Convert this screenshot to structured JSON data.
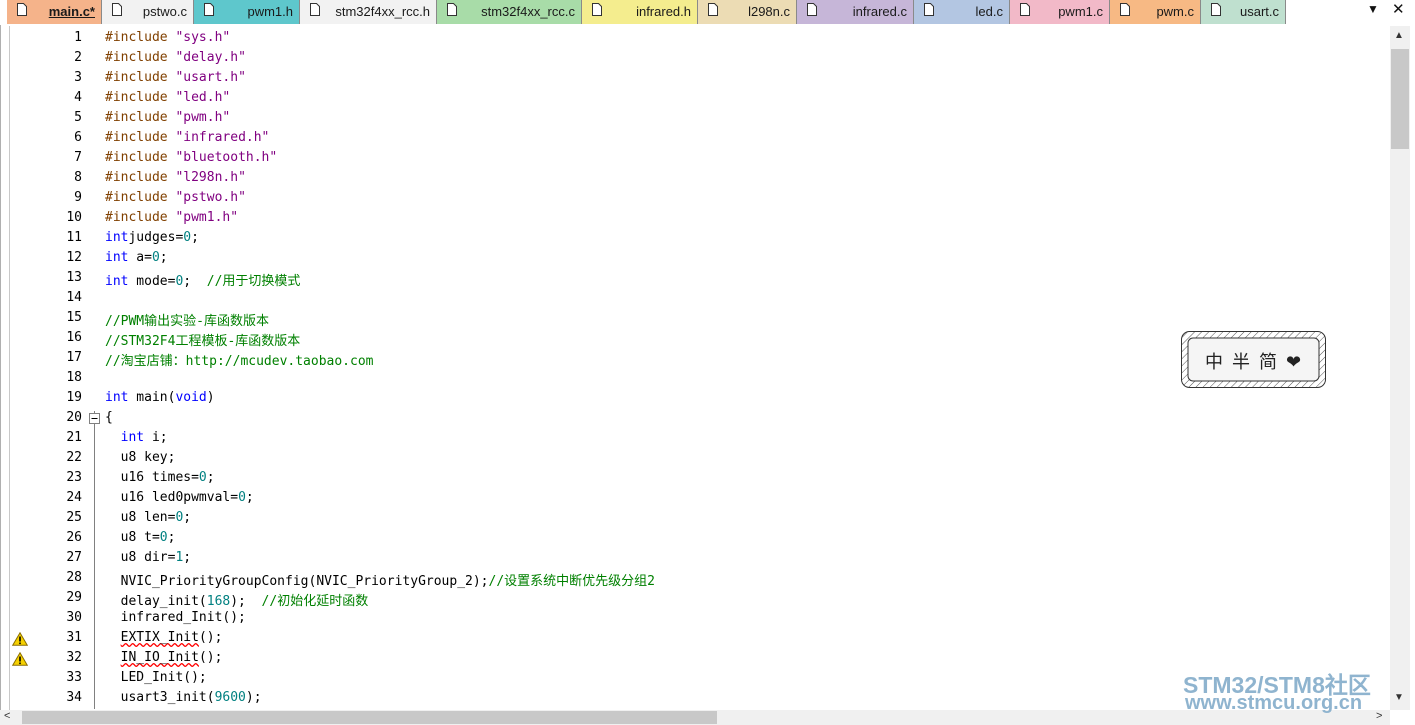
{
  "tabs": [
    {
      "label": "main.c*",
      "color": "#f5b38a",
      "active": true
    },
    {
      "label": "pstwo.c",
      "color": "#f2f2f2",
      "active": false
    },
    {
      "label": "pwm1.h",
      "color": "#5ec7cc",
      "active": false
    },
    {
      "label": "stm32f4xx_rcc.h",
      "color": "#f2f2f2",
      "active": false
    },
    {
      "label": "stm32f4xx_rcc.c",
      "color": "#a8dca8",
      "active": false
    },
    {
      "label": "infrared.h",
      "color": "#f4ed8e",
      "active": false
    },
    {
      "label": "l298n.c",
      "color": "#ecdcb4",
      "active": false
    },
    {
      "label": "infrared.c",
      "color": "#c6b6d8",
      "active": false
    },
    {
      "label": "led.c",
      "color": "#b3c6e2",
      "active": false
    },
    {
      "label": "pwm1.c",
      "color": "#f2b9c8",
      "active": false
    },
    {
      "label": "pwm.c",
      "color": "#f7b984",
      "active": false
    },
    {
      "label": "usart.c",
      "color": "#bfe0cf",
      "active": false
    }
  ],
  "tab_controls": {
    "menu": "▼",
    "close": "✕"
  },
  "lines": [
    {
      "n": "1",
      "seg": [
        [
          "pp",
          "#include "
        ],
        [
          "str",
          "\"sys.h\""
        ]
      ]
    },
    {
      "n": "2",
      "seg": [
        [
          "pp",
          "#include "
        ],
        [
          "str",
          "\"delay.h\""
        ]
      ]
    },
    {
      "n": "3",
      "seg": [
        [
          "pp",
          "#include "
        ],
        [
          "str",
          "\"usart.h\""
        ]
      ]
    },
    {
      "n": "4",
      "seg": [
        [
          "pp",
          "#include "
        ],
        [
          "str",
          "\"led.h\""
        ]
      ]
    },
    {
      "n": "5",
      "seg": [
        [
          "pp",
          "#include "
        ],
        [
          "str",
          "\"pwm.h\""
        ]
      ]
    },
    {
      "n": "6",
      "seg": [
        [
          "pp",
          "#include "
        ],
        [
          "str",
          "\"infrared.h\""
        ]
      ]
    },
    {
      "n": "7",
      "seg": [
        [
          "pp",
          "#include "
        ],
        [
          "str",
          "\"bluetooth.h\""
        ]
      ]
    },
    {
      "n": "8",
      "seg": [
        [
          "pp",
          "#include "
        ],
        [
          "str",
          "\"l298n.h\""
        ]
      ]
    },
    {
      "n": "9",
      "seg": [
        [
          "pp",
          "#include "
        ],
        [
          "str",
          "\"pstwo.h\""
        ]
      ]
    },
    {
      "n": "10",
      "seg": [
        [
          "pp",
          "#include "
        ],
        [
          "str",
          "\"pwm1.h\""
        ]
      ]
    },
    {
      "n": "11",
      "seg": [
        [
          "kw",
          "int"
        ],
        [
          "",
          "judges="
        ],
        [
          "num",
          "0"
        ],
        [
          "",
          ";"
        ]
      ]
    },
    {
      "n": "12",
      "seg": [
        [
          "kw",
          "int"
        ],
        [
          "",
          " a="
        ],
        [
          "num",
          "0"
        ],
        [
          "",
          ";"
        ]
      ]
    },
    {
      "n": "13",
      "seg": [
        [
          "kw",
          "int"
        ],
        [
          "",
          " mode="
        ],
        [
          "num",
          "0"
        ],
        [
          "",
          ";  "
        ],
        [
          "cmt",
          "//用于切换模式"
        ]
      ]
    },
    {
      "n": "14",
      "seg": []
    },
    {
      "n": "15",
      "seg": [
        [
          "cmt",
          "//PWM输出实验-库函数版本"
        ]
      ]
    },
    {
      "n": "16",
      "seg": [
        [
          "cmt",
          "//STM32F4工程模板-库函数版本"
        ]
      ]
    },
    {
      "n": "17",
      "seg": [
        [
          "cmt",
          "//淘宝店铺：http://mcudev.taobao.com"
        ]
      ]
    },
    {
      "n": "18",
      "seg": []
    },
    {
      "n": "19",
      "seg": [
        [
          "kw",
          "int"
        ],
        [
          "",
          " main("
        ],
        [
          "kw",
          "void"
        ],
        [
          "",
          ")"
        ]
      ]
    },
    {
      "n": "20",
      "seg": [
        [
          "",
          "{"
        ]
      ]
    },
    {
      "n": "21",
      "seg": [
        [
          "",
          "  "
        ],
        [
          "kw",
          "int"
        ],
        [
          "",
          " i;"
        ]
      ]
    },
    {
      "n": "22",
      "seg": [
        [
          "",
          "  u8 key;"
        ]
      ]
    },
    {
      "n": "23",
      "seg": [
        [
          "",
          "  u16 times="
        ],
        [
          "num",
          "0"
        ],
        [
          "",
          ";"
        ]
      ]
    },
    {
      "n": "24",
      "seg": [
        [
          "",
          "  u16 led0pwmval="
        ],
        [
          "num",
          "0"
        ],
        [
          "",
          ";"
        ]
      ]
    },
    {
      "n": "25",
      "seg": [
        [
          "",
          "  u8 len="
        ],
        [
          "num",
          "0"
        ],
        [
          "",
          ";"
        ]
      ]
    },
    {
      "n": "26",
      "seg": [
        [
          "",
          "  u8 t="
        ],
        [
          "num",
          "0"
        ],
        [
          "",
          ";"
        ]
      ]
    },
    {
      "n": "27",
      "seg": [
        [
          "",
          "  u8 dir="
        ],
        [
          "num",
          "1"
        ],
        [
          "",
          ";"
        ]
      ]
    },
    {
      "n": "28",
      "seg": [
        [
          "",
          "  NVIC_PriorityGroupConfig(NVIC_PriorityGroup_2);"
        ],
        [
          "cmt",
          "//设置系统中断优先级分组2"
        ]
      ]
    },
    {
      "n": "29",
      "seg": [
        [
          "",
          "  delay_init("
        ],
        [
          "num",
          "168"
        ],
        [
          "",
          ");  "
        ],
        [
          "cmt",
          "//初始化延时函数"
        ]
      ]
    },
    {
      "n": "30",
      "seg": [
        [
          "",
          "  infrared_Init();"
        ]
      ]
    },
    {
      "n": "31",
      "seg": [
        [
          "",
          "  "
        ],
        [
          "squiggle",
          "EXTIX_Init"
        ],
        [
          "",
          "();"
        ]
      ],
      "warn": true
    },
    {
      "n": "32",
      "seg": [
        [
          "",
          "  "
        ],
        [
          "squiggle",
          "IN_IO_Init"
        ],
        [
          "",
          "();"
        ]
      ],
      "warn": true
    },
    {
      "n": "33",
      "seg": [
        [
          "",
          "  LED_Init();"
        ]
      ]
    },
    {
      "n": "34",
      "seg": [
        [
          "",
          "  usart3_init("
        ],
        [
          "num",
          "9600"
        ],
        [
          "",
          ");"
        ]
      ]
    }
  ],
  "ime": {
    "text": "中 半 简 ❤"
  },
  "watermark": {
    "line1": "STM32/STM8社区",
    "line2": "www.stmcu.org.cn"
  },
  "scroll": {
    "up": "▲",
    "down": "▼",
    "left": "<",
    "right": ">"
  }
}
